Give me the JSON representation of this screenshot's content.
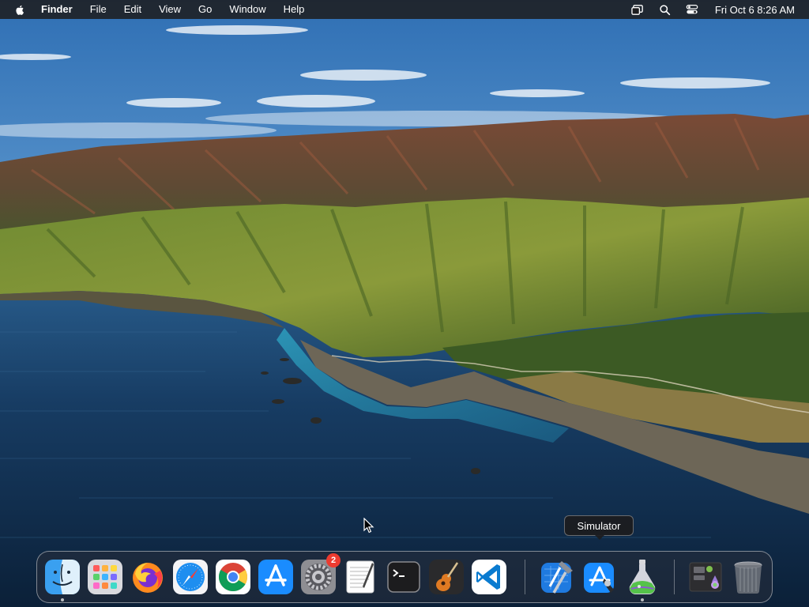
{
  "menubar": {
    "apple_icon": "apple-logo-icon",
    "app_name": "Finder",
    "menus": [
      "File",
      "Edit",
      "View",
      "Go",
      "Window",
      "Help"
    ],
    "status_icons": [
      "screen-mirroring-icon",
      "spotlight-search-icon",
      "control-center-icon"
    ],
    "clock": "Fri Oct 6  8:26 AM"
  },
  "tooltip": {
    "text": "Simulator"
  },
  "dock": {
    "apps": [
      {
        "name": "Finder",
        "icon": "finder-icon",
        "running": true
      },
      {
        "name": "Launchpad",
        "icon": "launchpad-icon",
        "running": false
      },
      {
        "name": "Firefox",
        "icon": "firefox-icon",
        "running": false
      },
      {
        "name": "Safari",
        "icon": "safari-icon",
        "running": false
      },
      {
        "name": "Google Chrome",
        "icon": "chrome-icon",
        "running": false
      },
      {
        "name": "App Store",
        "icon": "app-store-icon",
        "running": false
      },
      {
        "name": "System Settings",
        "icon": "system-settings-icon",
        "running": false,
        "badge": "2"
      },
      {
        "name": "TextEdit",
        "icon": "textedit-icon",
        "running": false
      },
      {
        "name": "Terminal",
        "icon": "terminal-icon",
        "running": false
      },
      {
        "name": "GarageBand",
        "icon": "garageband-icon",
        "running": false
      },
      {
        "name": "Visual Studio Code",
        "icon": "vscode-icon",
        "running": false
      },
      {
        "name": "Xcode",
        "icon": "xcode-icon",
        "running": false
      },
      {
        "name": "Instruments",
        "icon": "instruments-icon",
        "running": false
      },
      {
        "name": "Simulator",
        "icon": "simulator-icon",
        "running": true
      }
    ],
    "others": [
      {
        "name": "Downloads",
        "icon": "downloads-stack-icon"
      },
      {
        "name": "Trash",
        "icon": "trash-icon"
      }
    ]
  }
}
